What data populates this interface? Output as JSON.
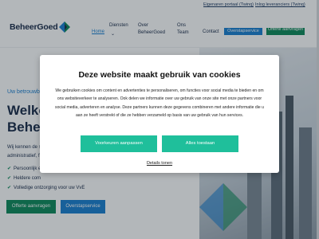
{
  "topbar": {
    "link1": "Eigenaren portaal (Twinq)",
    "link2": "Inlog leveranciers (Twinq)"
  },
  "nav": {
    "logo_text": "BeheerGoed",
    "home": "Home",
    "diensten": "Diensten",
    "chevron": "⌄",
    "over": "Over BeheerGoed",
    "ons_team": "Ons Team",
    "contact": "Contact",
    "overstap": "Overstapservice",
    "offerte": "Offerte aanvragen"
  },
  "hero": {
    "kicker": "Uw betrouwb",
    "title_line1": "Welko",
    "title_line2": "Behee",
    "text_line1": "Wij kennen de s",
    "text_line2": "administratief, f",
    "check1": "Persoonlijk e",
    "check2": "Heldere com",
    "check3": "Volledige ontzorging voor uw VvE",
    "btn_offerte": "Offerte aanvragen",
    "btn_overstap": "Overstapservice"
  },
  "cookie": {
    "title": "Deze website maakt gebruik van cookies",
    "text": "We gebruiken cookies om content en advertenties te personaliseren, om functies voor social media te bieden en om ons websiteverkeer te analyseren. Ook delen we informatie over uw gebruik van onze site met onze partners voor social media, adverteren en analyse. Deze partners kunnen deze gegevens combineren met andere informatie die u aan ze heeft verstrekt of die ze hebben verzameld op basis van uw gebruik van hun services.",
    "btn_customize": "Voorkeuren aanpassen",
    "btn_allow": "Alles toestaan",
    "details": "Details tonen"
  },
  "colors": {
    "accent_green": "#1fbf9b",
    "brand_navy": "#1a2b49",
    "brand_blue": "#1a7fd0",
    "brand_green": "#0e8a5a"
  }
}
